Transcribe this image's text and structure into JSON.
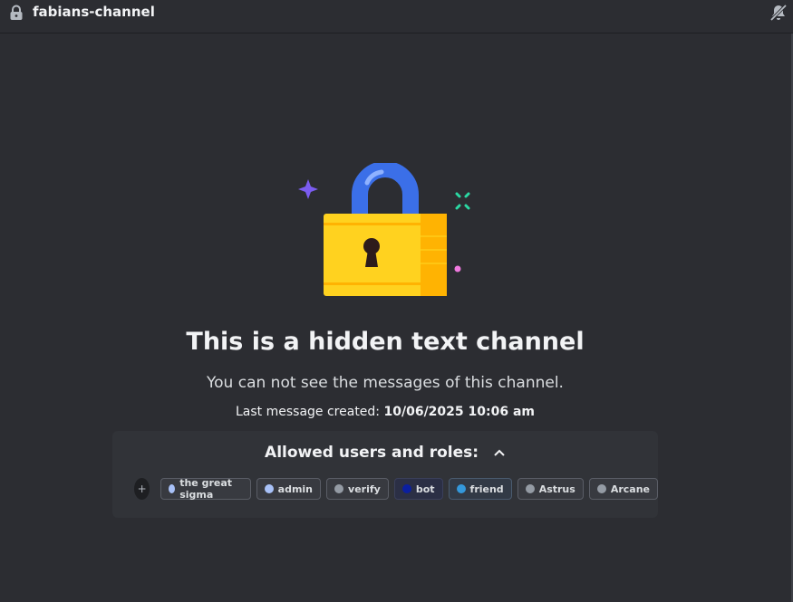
{
  "header": {
    "channel_name": "fabians-channel",
    "left_icon": "lock-icon",
    "right_icon": "mute-notifications-icon"
  },
  "main": {
    "title": "This is a hidden text channel",
    "subtitle": "You can not see the messages of this channel.",
    "last_message_label": "Last message created:",
    "last_message_value": "10/06/2025 10:06 am"
  },
  "roles": {
    "header": "Allowed users and roles:",
    "add_label": "+",
    "items": [
      {
        "label": "the great sigma",
        "color": "#a8c1f7"
      },
      {
        "label": "admin",
        "color": "#a8c1f7"
      },
      {
        "label": "verify",
        "color": "#949ba4"
      },
      {
        "label": "bot",
        "color": "#0b1fa0"
      },
      {
        "label": "friend",
        "color": "#3498db"
      },
      {
        "label": "Astrus",
        "color": "#949ba4"
      },
      {
        "label": "Arcane",
        "color": "#949ba4"
      }
    ]
  },
  "colors": {
    "background": "#2c2d32",
    "panel": "#313338",
    "lock_body": "#ffd21f",
    "lock_shackle": "#3b6fe8"
  }
}
